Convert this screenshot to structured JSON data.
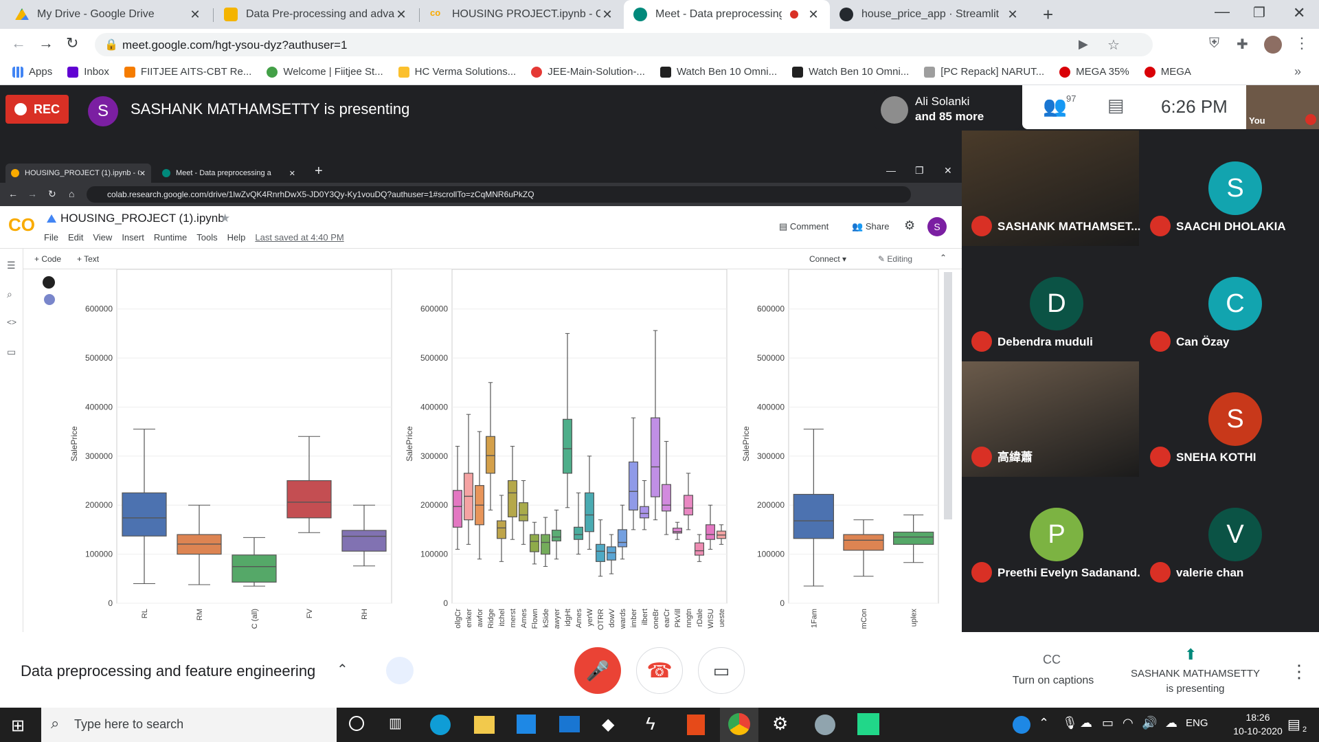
{
  "browser": {
    "tabs": [
      {
        "label": "My Drive - Google Drive",
        "active": false
      },
      {
        "label": "Data Pre-processing and advance",
        "active": false
      },
      {
        "label": "HOUSING PROJECT.ipynb - Colab",
        "active": false
      },
      {
        "label": "Meet - Data preprocessing a",
        "active": true
      },
      {
        "label": "house_price_app · Streamlit",
        "active": false
      }
    ],
    "url": "meet.google.com/hgt-ysou-dyz?authuser=1",
    "bookmarks": [
      "Apps",
      "Inbox",
      "FIITJEE AITS-CBT Re...",
      "Welcome | Fiitjee St...",
      "HC Verma Solutions...",
      "JEE-Main-Solution-...",
      "Watch Ben 10 Omni...",
      "Watch Ben 10 Omni...",
      "[PC Repack] NARUT...",
      "MEGA 35%",
      "MEGA"
    ]
  },
  "meet": {
    "rec_label": "REC",
    "presenter_initial": "S",
    "presenting_text": "SASHANK MATHAMSETTY is presenting",
    "others_name": "Ali Solanki",
    "others_more": "and 85 more",
    "participant_count": "97",
    "time": "6:26 PM",
    "self_label": "You",
    "meeting_title": "Data preprocessing and feature engineering",
    "captions_label": "Turn on captions",
    "presenting_name": "SASHANK MATHAMSETTY",
    "presenting_sub": "is presenting",
    "participants": [
      {
        "name": "SASHANK MATHAMSET...",
        "initial": "",
        "color": "#4a3b2a",
        "video": true
      },
      {
        "name": "SAACHI DHOLAKIA",
        "initial": "S",
        "color": "#12a4af"
      },
      {
        "name": "Debendra muduli",
        "initial": "D",
        "color": "#0b5345"
      },
      {
        "name": "Can Özay",
        "initial": "C",
        "color": "#12a4af"
      },
      {
        "name": "高緯蕭",
        "initial": "",
        "color": "#6b5b4b",
        "video": true
      },
      {
        "name": "SNEHA KOTHI",
        "initial": "S",
        "color": "#c8381a"
      },
      {
        "name": "Preethi Evelyn Sadanand...",
        "initial": "P",
        "color": "#7cb342"
      },
      {
        "name": "valerie chan",
        "initial": "V",
        "color": "#0b5345"
      }
    ]
  },
  "share": {
    "inner_tabs": [
      "HOUSING_PROJECT (1).ipynb - C",
      "Meet - Data preprocessing a"
    ],
    "inner_url": "colab.research.google.com/drive/1lwZvQK4RnrhDwX5-JD0Y3Qy-Ky1vouDQ?authuser=1#scrollTo=zCqMNR6uPkZQ",
    "notebook_title": "HOUSING_PROJECT (1).ipynb",
    "menu": [
      "File",
      "Edit",
      "View",
      "Insert",
      "Runtime",
      "Tools",
      "Help"
    ],
    "last_saved": "Last saved at 4:40 PM",
    "comment": "Comment",
    "share": "Share",
    "user_initial": "S",
    "code_btn": "+ Code",
    "text_btn": "+ Text",
    "connect": "Connect",
    "editing": "Editing"
  },
  "chart_data": [
    {
      "type": "box",
      "ylabel": "SalePrice",
      "ylim": [
        0,
        650000
      ],
      "yticks": [
        "0",
        "100000",
        "200000",
        "300000",
        "400000",
        "500000",
        "600000"
      ],
      "categories": [
        "RL",
        "RM",
        "C (all)",
        "FV",
        "RH"
      ],
      "colors": [
        "#4c72b0",
        "#dd8452",
        "#55a868",
        "#c44e52",
        "#8172b2"
      ],
      "boxes": [
        {
          "min": 40000,
          "q1": 137000,
          "median": 174000,
          "q3": 225000,
          "max": 355000
        },
        {
          "min": 37900,
          "q1": 100000,
          "median": 120500,
          "q3": 140000,
          "max": 200000
        },
        {
          "min": 34900,
          "q1": 43000,
          "median": 74700,
          "q3": 98300,
          "max": 133900
        },
        {
          "min": 144000,
          "q1": 174000,
          "median": 205950,
          "q3": 250000,
          "max": 340000
        },
        {
          "min": 76000,
          "q1": 106150,
          "median": 136500,
          "q3": 148500,
          "max": 200000
        }
      ]
    },
    {
      "type": "box",
      "ylabel": "SalePrice",
      "ylim": [
        0,
        650000
      ],
      "yticks": [
        "0",
        "100000",
        "200000",
        "300000",
        "400000",
        "500000",
        "600000"
      ],
      "categories": [
        "ollgCr",
        "enker",
        "awfor",
        "Ridge",
        "itchel",
        "merst",
        "Ames",
        "Flown",
        "kSide",
        "awyer",
        "idgHt",
        "Ames",
        "yerW",
        "OTRR",
        "dowV",
        "wards",
        "imber",
        "ilbert",
        "oneBr",
        "earCr",
        "PkVill",
        "nngtn",
        "rDale",
        "WISU",
        "ueste"
      ],
      "colors": [
        "#e377c2",
        "#f5a3a3",
        "#e8955a",
        "#d4a04a",
        "#bfa54a",
        "#b5a84a",
        "#a9ab4a",
        "#8fab4a",
        "#74ac5a",
        "#5aad74",
        "#4eae8a",
        "#4aad9e",
        "#4aabb2",
        "#4ea9c4",
        "#5aa5d4",
        "#74a0e0",
        "#8f9ae8",
        "#aa94ea",
        "#c08fe6",
        "#d28ade",
        "#e086d2",
        "#e988c2",
        "#ee8cb2"
      ],
      "boxes": [
        {
          "min": 110000,
          "q1": 155000,
          "median": 197200,
          "q3": 230000,
          "max": 320000
        },
        {
          "min": 120000,
          "q1": 170000,
          "median": 218000,
          "q3": 265000,
          "max": 385000
        },
        {
          "min": 90000,
          "q1": 160000,
          "median": 200000,
          "q3": 240000,
          "max": 350000
        },
        {
          "min": 190000,
          "q1": 265000,
          "median": 301000,
          "q3": 340000,
          "max": 450000
        },
        {
          "min": 85000,
          "q1": 132000,
          "median": 153500,
          "q3": 168000,
          "max": 220000
        },
        {
          "min": 130000,
          "q1": 176000,
          "median": 225000,
          "q3": 250000,
          "max": 320000
        },
        {
          "min": 120000,
          "q1": 168000,
          "median": 180000,
          "q3": 205000,
          "max": 250000
        },
        {
          "min": 80000,
          "q1": 105000,
          "median": 126000,
          "q3": 140000,
          "max": 165000
        },
        {
          "min": 75000,
          "q1": 100000,
          "median": 124000,
          "q3": 140000,
          "max": 175000
        },
        {
          "min": 90000,
          "q1": 127000,
          "median": 135000,
          "q3": 149000,
          "max": 190000
        },
        {
          "min": 195000,
          "q1": 265000,
          "median": 315000,
          "q3": 375000,
          "max": 550000
        },
        {
          "min": 100000,
          "q1": 130000,
          "median": 140000,
          "q3": 155000,
          "max": 225000
        },
        {
          "min": 110000,
          "q1": 146000,
          "median": 180000,
          "q3": 225000,
          "max": 300000
        },
        {
          "min": 55000,
          "q1": 85000,
          "median": 106000,
          "q3": 120000,
          "max": 170000
        },
        {
          "min": 60000,
          "q1": 88000,
          "median": 103000,
          "q3": 115000,
          "max": 140000
        },
        {
          "min": 90000,
          "q1": 115000,
          "median": 124000,
          "q3": 150000,
          "max": 200000
        },
        {
          "min": 150000,
          "q1": 190000,
          "median": 228000,
          "q3": 288000,
          "max": 378000
        },
        {
          "min": 150000,
          "q1": 174000,
          "median": 183000,
          "q3": 197000,
          "max": 250000
        },
        {
          "min": 170000,
          "q1": 217000,
          "median": 278000,
          "q3": 378000,
          "max": 556000
        },
        {
          "min": 140000,
          "q1": 188000,
          "median": 200000,
          "q3": 242000,
          "max": 330000
        },
        {
          "min": 130000,
          "q1": 143000,
          "median": 146000,
          "q3": 153000,
          "max": 165000
        },
        {
          "min": 150000,
          "q1": 180000,
          "median": 194000,
          "q3": 220000,
          "max": 265000
        },
        {
          "min": 85000,
          "q1": 98000,
          "median": 107000,
          "q3": 123000,
          "max": 140000
        },
        {
          "min": 110000,
          "q1": 130000,
          "median": 140000,
          "q3": 160000,
          "max": 200000
        },
        {
          "min": 120000,
          "q1": 132000,
          "median": 139000,
          "q3": 147000,
          "max": 160000
        }
      ]
    },
    {
      "type": "box",
      "ylabel": "SalePrice",
      "ylim": [
        0,
        650000
      ],
      "yticks": [
        "0",
        "100000",
        "200000",
        "300000",
        "400000",
        "500000",
        "600000"
      ],
      "categories": [
        "1Fam",
        "mCon",
        "uplex"
      ],
      "colors": [
        "#4c72b0",
        "#dd8452",
        "#55a868"
      ],
      "boxes": [
        {
          "min": 35000,
          "q1": 132000,
          "median": 168000,
          "q3": 222000,
          "max": 355000
        },
        {
          "min": 55000,
          "q1": 108000,
          "median": 128500,
          "q3": 140000,
          "max": 170000
        },
        {
          "min": 83000,
          "q1": 120000,
          "median": 135000,
          "q3": 145000,
          "max": 180000
        }
      ]
    }
  ],
  "taskbar": {
    "search_placeholder": "Type here to search",
    "lang": "ENG",
    "time": "18:26",
    "date": "10-10-2020",
    "notif_count": "2"
  },
  "colors": {
    "rec": "#d93025",
    "meet_bg": "#202124",
    "hangup": "#ea4335"
  }
}
